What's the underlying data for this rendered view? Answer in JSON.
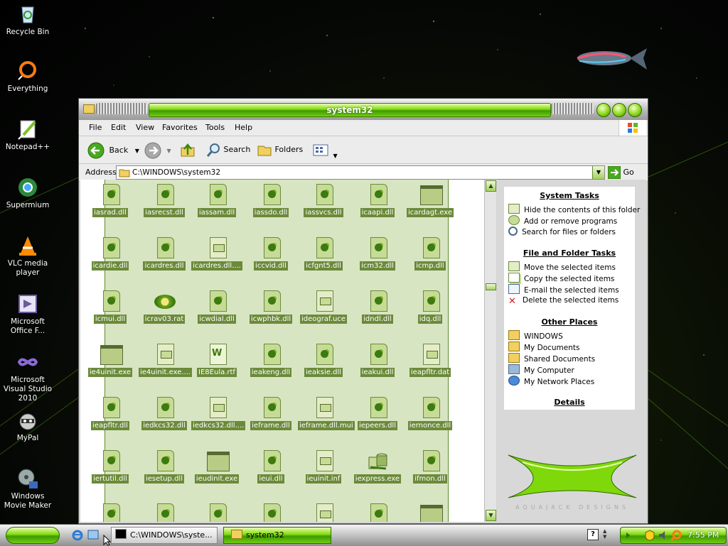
{
  "desktop": {
    "icons": [
      {
        "label": "Recycle Bin",
        "icon": "recycle-bin-icon"
      },
      {
        "label": "Everything",
        "icon": "everything-search-icon"
      },
      {
        "label": "Notepad++",
        "icon": "notepad-plus-plus-icon"
      },
      {
        "label": "Supermium",
        "icon": "supermium-browser-icon"
      },
      {
        "label": "VLC media player",
        "icon": "vlc-cone-icon"
      },
      {
        "label": "Microsoft Office F...",
        "icon": "office-frontpage-icon"
      },
      {
        "label": "Microsoft Visual Studio 2010",
        "icon": "visual-studio-icon"
      },
      {
        "label": "MyPal",
        "icon": "mypal-raccoon-icon"
      },
      {
        "label": "Windows Movie Maker",
        "icon": "movie-maker-icon"
      }
    ]
  },
  "window": {
    "title": "system32",
    "menu": [
      "File",
      "Edit",
      "View",
      "Favorites",
      "Tools",
      "Help"
    ],
    "toolbar": {
      "back": "Back",
      "search": "Search",
      "folders": "Folders"
    },
    "address": {
      "label": "Address",
      "value": "C:\\WINDOWS\\system32",
      "go": "Go"
    },
    "files": [
      {
        "name": "iasrad.dll",
        "type": "dll"
      },
      {
        "name": "iasrecst.dll",
        "type": "dll"
      },
      {
        "name": "iassam.dll",
        "type": "dll"
      },
      {
        "name": "iassdo.dll",
        "type": "dll"
      },
      {
        "name": "iassvcs.dll",
        "type": "dll"
      },
      {
        "name": "icaapi.dll",
        "type": "dll"
      },
      {
        "name": "icardagt.exe",
        "type": "exe"
      },
      {
        "name": "icardie.dll",
        "type": "dll"
      },
      {
        "name": "icardres.dll",
        "type": "dll"
      },
      {
        "name": "icardres.dll....",
        "type": "doc"
      },
      {
        "name": "iccvid.dll",
        "type": "dll"
      },
      {
        "name": "icfgnt5.dll",
        "type": "dll"
      },
      {
        "name": "icm32.dll",
        "type": "dll"
      },
      {
        "name": "icmp.dll",
        "type": "dll"
      },
      {
        "name": "icmui.dll",
        "type": "dll"
      },
      {
        "name": "icrav03.rat",
        "type": "rat"
      },
      {
        "name": "icwdial.dll",
        "type": "dll"
      },
      {
        "name": "icwphbk.dll",
        "type": "dll"
      },
      {
        "name": "ideograf.uce",
        "type": "doc"
      },
      {
        "name": "idndl.dll",
        "type": "dll"
      },
      {
        "name": "idq.dll",
        "type": "dll"
      },
      {
        "name": "ie4uinit.exe",
        "type": "exe"
      },
      {
        "name": "ie4uinit.exe....",
        "type": "doc"
      },
      {
        "name": "IE8Eula.rtf",
        "type": "word"
      },
      {
        "name": "ieakeng.dll",
        "type": "dll"
      },
      {
        "name": "ieaksie.dll",
        "type": "dll"
      },
      {
        "name": "ieakui.dll",
        "type": "dll"
      },
      {
        "name": "ieapfltr.dat",
        "type": "doc"
      },
      {
        "name": "ieapfltr.dll",
        "type": "dll"
      },
      {
        "name": "iedkcs32.dll",
        "type": "dll"
      },
      {
        "name": "iedkcs32.dll....",
        "type": "doc"
      },
      {
        "name": "ieframe.dll",
        "type": "dll"
      },
      {
        "name": "ieframe.dll.mui",
        "type": "doc"
      },
      {
        "name": "iepeers.dll",
        "type": "dll"
      },
      {
        "name": "iernonce.dll",
        "type": "dll"
      },
      {
        "name": "iertutil.dll",
        "type": "dll"
      },
      {
        "name": "iesetup.dll",
        "type": "dll"
      },
      {
        "name": "ieudinit.exe",
        "type": "exe"
      },
      {
        "name": "ieui.dll",
        "type": "dll"
      },
      {
        "name": "ieuinit.inf",
        "type": "doc"
      },
      {
        "name": "iexpress.exe",
        "type": "pkg"
      },
      {
        "name": "ifmon.dll",
        "type": "dll"
      },
      {
        "name": "",
        "type": "dll"
      },
      {
        "name": "",
        "type": "dll"
      },
      {
        "name": "",
        "type": "dll"
      },
      {
        "name": "",
        "type": "dll"
      },
      {
        "name": "",
        "type": "doc"
      },
      {
        "name": "",
        "type": "dll"
      },
      {
        "name": "",
        "type": "exe"
      }
    ],
    "taskpane": {
      "system_tasks": {
        "title": "System Tasks",
        "items": [
          {
            "label": "Hide the contents of this folder",
            "icon": "hide-contents-icon"
          },
          {
            "label": "Add or remove programs",
            "icon": "add-remove-programs-icon"
          },
          {
            "label": "Search for files or folders",
            "icon": "search-icon"
          }
        ]
      },
      "file_tasks": {
        "title": "File and Folder Tasks",
        "items": [
          {
            "label": "Move the selected items",
            "icon": "move-icon"
          },
          {
            "label": "Copy the selected items",
            "icon": "copy-icon"
          },
          {
            "label": "E-mail the selected items",
            "icon": "email-icon"
          },
          {
            "label": "Delete the selected items",
            "icon": "delete-x-icon"
          }
        ]
      },
      "other_places": {
        "title": "Other Places",
        "items": [
          {
            "label": "WINDOWS",
            "icon": "folder-icon"
          },
          {
            "label": "My Documents",
            "icon": "my-documents-icon"
          },
          {
            "label": "Shared Documents",
            "icon": "shared-folder-icon"
          },
          {
            "label": "My Computer",
            "icon": "my-computer-icon"
          },
          {
            "label": "My Network Places",
            "icon": "network-places-icon"
          }
        ]
      },
      "details": {
        "title": "Details"
      },
      "logo_text": "AQUAJACK DESIGNS"
    }
  },
  "taskbar": {
    "tasks": [
      {
        "label": "C:\\WINDOWS\\syste...",
        "icon": "cmd-icon"
      },
      {
        "label": "system32",
        "icon": "folder-icon"
      }
    ],
    "clock": "7:55 PM"
  },
  "colors": {
    "accent_green": "#7fd80a",
    "selection_green": "#6b8a3a"
  }
}
